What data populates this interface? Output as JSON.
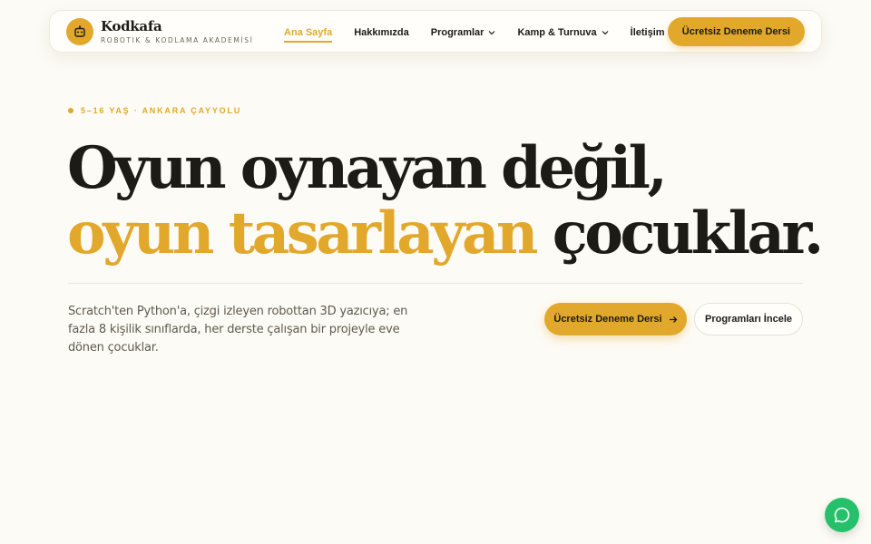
{
  "brand": {
    "name": "Kodkafa",
    "tagline": "ROBOTIK & KODLAMA AKADEMİSİ",
    "logo_icon": "robot-icon"
  },
  "nav": {
    "items": [
      {
        "label": "Ana Sayfa",
        "active": true,
        "has_dropdown": false
      },
      {
        "label": "Hakkımızda",
        "active": false,
        "has_dropdown": false
      },
      {
        "label": "Programlar",
        "active": false,
        "has_dropdown": true
      },
      {
        "label": "Kamp & Turnuva",
        "active": false,
        "has_dropdown": true
      },
      {
        "label": "İletişim",
        "active": false,
        "has_dropdown": false
      }
    ],
    "cta_label": "Ücretsiz Deneme Dersi"
  },
  "hero": {
    "eyebrow": "5–16 YAŞ · ANKARA ÇAYYOLU",
    "headline_line1": "Oyun oynayan değil,",
    "headline_accent": "oyun tasarlayan",
    "headline_rest": " çocuklar.",
    "lead": "Scratch'ten Python'a, çizgi izleyen robottan 3D yazıcıya; en fazla 8 kişilik sınıflarda, her derste çalışan bir projeyle eve dönen çocuklar.",
    "primary_cta": "Ücretsiz Deneme Dersi",
    "secondary_cta": "Programları İncele"
  },
  "colors": {
    "accent": "#e2a82c",
    "background": "#fdfbf5",
    "text": "#1c1b16",
    "chat": "#25c06a"
  },
  "chat": {
    "icon": "chat-bubble-icon"
  }
}
